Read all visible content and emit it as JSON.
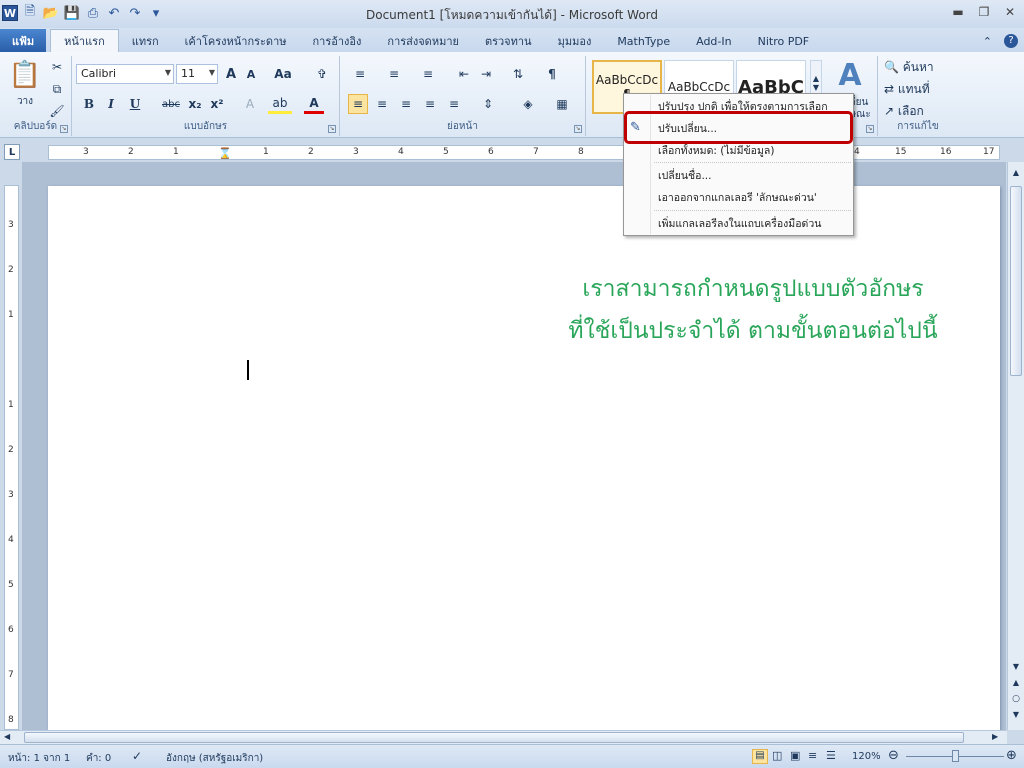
{
  "app": {
    "title": "Document1 [โหมดความเข้ากันได้] - Microsoft Word",
    "logo_letter": "W"
  },
  "qat": {
    "icons": [
      "new-icon",
      "open-icon",
      "save-icon",
      "print-preview-icon",
      "undo-icon",
      "redo-icon",
      "customize-qat-icon"
    ]
  },
  "tabs": [
    {
      "label": "แฟ้ม",
      "type": "file"
    },
    {
      "label": "หน้าแรก",
      "type": "active"
    },
    {
      "label": "แทรก"
    },
    {
      "label": "เค้าโครงหน้ากระดาษ"
    },
    {
      "label": "การอ้างอิง"
    },
    {
      "label": "การส่งจดหมาย"
    },
    {
      "label": "ตรวจทาน"
    },
    {
      "label": "มุมมอง"
    },
    {
      "label": "MathType"
    },
    {
      "label": "Add-In"
    },
    {
      "label": "Nitro PDF"
    }
  ],
  "ribbon": {
    "clipboard": {
      "label": "คลิปบอร์ด",
      "paste": "วาง"
    },
    "font": {
      "label": "แบบอักษร",
      "name": "Calibri",
      "size": "11",
      "grow": "A",
      "shrink": "A",
      "case": "Aa",
      "bold": "B",
      "italic": "I",
      "underline": "U",
      "strike": "abc",
      "sub": "x₂",
      "sup": "x²"
    },
    "paragraph": {
      "label": "ย่อหน้า"
    },
    "styles": {
      "samples": [
        "AaBbCcDc",
        "AaBbCcDc",
        "AaBbC"
      ],
      "first_sub": "¶",
      "change": "เปลี่ยน",
      "change_sub": "ลักษณะ"
    },
    "editing": {
      "label": "การแก้ไข",
      "find": "ค้นหา",
      "replace": "แทนที่",
      "select": "เลือก"
    }
  },
  "context_menu": {
    "items": [
      "ปรับปรุง ปกติ เพื่อให้ตรงตามการเลือก",
      "ปรับเปลี่ยน...",
      "เลือกทั้งหมด: (ไม่มีข้อมูล)",
      "เปลี่ยนชื่อ...",
      "เอาออกจากแกลเลอรี 'ลักษณะด่วน'",
      "เพิ่มแกลเลอรีลงในแถบเครื่องมือด่วน"
    ]
  },
  "ruler": {
    "h_marks": [
      "3",
      "2",
      "1",
      "1",
      "2",
      "3",
      "4",
      "5",
      "6",
      "7",
      "8",
      "4",
      "15",
      "16",
      "17"
    ],
    "v_marks": [
      "3",
      "2",
      "1",
      "1",
      "2",
      "3",
      "4",
      "5",
      "6",
      "7",
      "8"
    ],
    "corner": "L"
  },
  "document": {
    "overlay_line1": "เราสามารถกำหนดรูปแบบตัวอักษร",
    "overlay_line2": "ที่ใช้เป็นประจำได้ ตามขั้นตอนต่อไปนี้"
  },
  "status": {
    "page": "หน้า: 1 จาก 1",
    "words": "คำ: 0",
    "language": "อังกฤษ (สหรัฐอเมริกา)",
    "zoom": "120%"
  },
  "colors": {
    "accent": "#2b579a",
    "highlight": "#c00000",
    "overlay_text": "#2aa65a"
  }
}
